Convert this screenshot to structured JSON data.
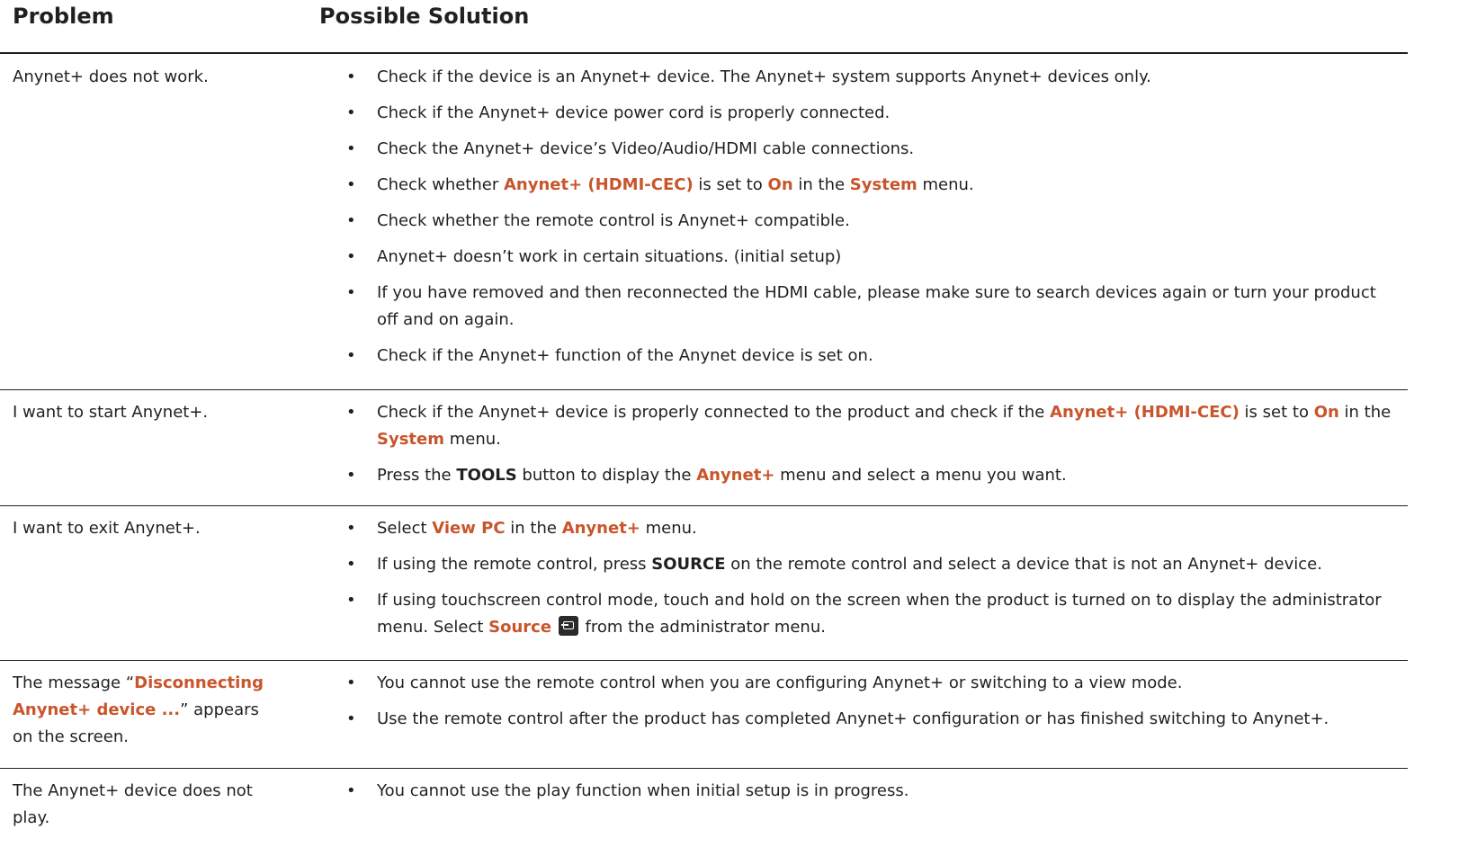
{
  "header": {
    "problem": "Problem",
    "solution": "Possible Solution"
  },
  "rows": [
    {
      "problem": "Anynet+ does not work.",
      "solutions": [
        {
          "t": [
            "Check if the device is an Anynet+ device. The Anynet+ system supports Anynet+ devices only."
          ]
        },
        {
          "t": [
            "Check if the Anynet+ device power cord is properly connected."
          ]
        },
        {
          "t": [
            "Check the Anynet+ device’s Video/Audio/HDMI cable connections."
          ]
        },
        {
          "t": [
            "Check whether ",
            "Anynet+ (HDMI-CEC)",
            " is set to ",
            "On",
            " in the ",
            "System",
            " menu."
          ]
        },
        {
          "t": [
            "Check whether the remote control is Anynet+ compatible."
          ]
        },
        {
          "t": [
            "Anynet+ doesn’t work in certain situations. (initial setup)"
          ]
        },
        {
          "t": [
            "If you have removed and then reconnected the HDMI cable, please make sure to search devices again or turn your product off and on again."
          ]
        },
        {
          "t": [
            "Check if the Anynet+ function of the Anynet device is set on."
          ]
        }
      ]
    },
    {
      "problem": "I want to start Anynet+.",
      "solutions": [
        {
          "t": [
            "Check if the Anynet+ device is properly connected to the product and check if the ",
            "Anynet+ (HDMI-CEC)",
            " is set to ",
            "On",
            " in the ",
            "System",
            " menu."
          ]
        },
        {
          "t": [
            "Press the ",
            "TOOLS",
            " button to display the ",
            "Anynet+",
            " menu and select a menu you want."
          ]
        }
      ]
    },
    {
      "problem": "I want to exit Anynet+.",
      "solutions": [
        {
          "t": [
            "Select ",
            "View PC",
            " in the ",
            "Anynet+",
            " menu."
          ]
        },
        {
          "t": [
            "If using the remote control, press ",
            "SOURCE",
            " on the remote control and select a device that is not an Anynet+ device."
          ]
        },
        {
          "t": [
            "If using touchscreen control mode, touch and hold on the screen when the product is turned on to display the administrator menu. Select ",
            "Source",
            " from the administrator menu."
          ]
        }
      ]
    },
    {
      "problem_parts": [
        "The message “",
        "Disconnecting Anynet+ device ...",
        "” appears on the screen."
      ],
      "solutions": [
        {
          "t": [
            "You cannot use the remote control when you are configuring Anynet+ or switching to a view mode."
          ]
        },
        {
          "t": [
            "Use the remote control after the product has completed Anynet+ configuration or has finished switching to Anynet+."
          ]
        }
      ]
    },
    {
      "problem": "The Anynet+ device does not play.",
      "solutions": [
        {
          "t": [
            "You cannot use the play function when initial setup is in progress."
          ]
        }
      ]
    }
  ],
  "icons": {
    "source": "source-input-icon"
  },
  "colors": {
    "highlight": "#c8552b",
    "text": "#231f20"
  }
}
